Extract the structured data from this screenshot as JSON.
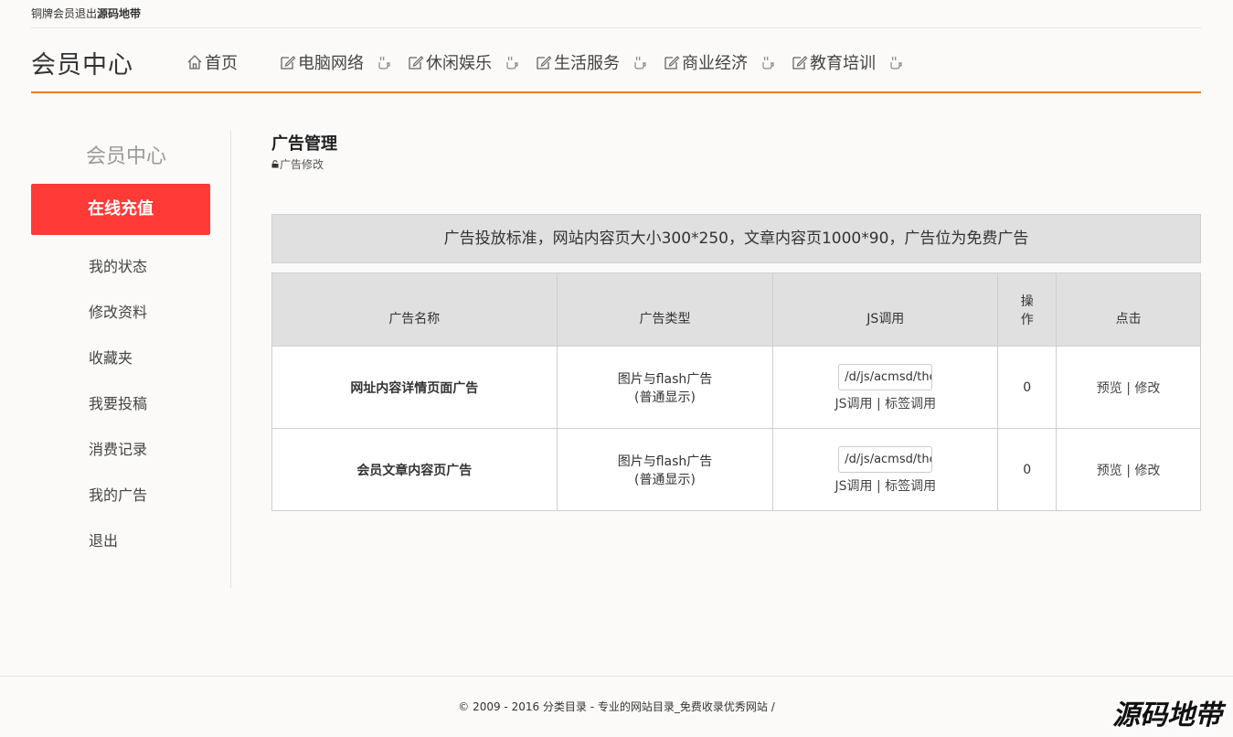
{
  "topbar": {
    "member_level": "铜牌会员",
    "logout": "退出",
    "site_name": "源码地带"
  },
  "header": {
    "brand": "会员中心",
    "nav": [
      {
        "label": "首页",
        "icon": "home-icon"
      },
      {
        "label": "电脑网络",
        "icon": "edit-icon"
      },
      {
        "label": "休闲娱乐",
        "icon": "edit-icon"
      },
      {
        "label": "生活服务",
        "icon": "edit-icon"
      },
      {
        "label": "商业经济",
        "icon": "edit-icon"
      },
      {
        "label": "教育培训",
        "icon": "edit-icon"
      }
    ]
  },
  "sidebar": {
    "title": "会员中心",
    "recharge": "在线充值",
    "items": [
      "我的状态",
      "修改资料",
      "收藏夹",
      "我要投稿",
      "消费记录",
      "我的广告",
      "退出"
    ]
  },
  "main": {
    "title": "广告管理",
    "crumb": "广告修改",
    "notice": "广告投放标准，网站内容页大小300*250，文章内容页1000*90，广告位为免费广告",
    "table": {
      "headers": {
        "name": "广告名称",
        "type": "广告类型",
        "js": "JS调用",
        "op1": "操",
        "op2": "作",
        "click": "点击"
      },
      "rows": [
        {
          "name": "网址内容详情页面广告",
          "type": "图片与flash广告",
          "type_sub": "(普通显示)",
          "js_value": "/d/js/acmsd/thea",
          "js_link": "JS调用",
          "tag_link": "标签调用",
          "count": "0",
          "preview": "预览",
          "edit": "修改"
        },
        {
          "name": "会员文章内容页广告",
          "type": "图片与flash广告",
          "type_sub": "(普通显示)",
          "js_value": "/d/js/acmsd/thea",
          "js_link": "JS调用",
          "tag_link": "标签调用",
          "count": "0",
          "preview": "预览",
          "edit": "修改"
        }
      ]
    }
  },
  "footer": {
    "text": "© 2009 - 2016 分类目录 - 专业的网站目录_免费收录优秀网站 /"
  },
  "watermark": "源码地带",
  "colors": {
    "accent_orange": "#e87b2c",
    "recharge_red": "#ff3a37"
  }
}
